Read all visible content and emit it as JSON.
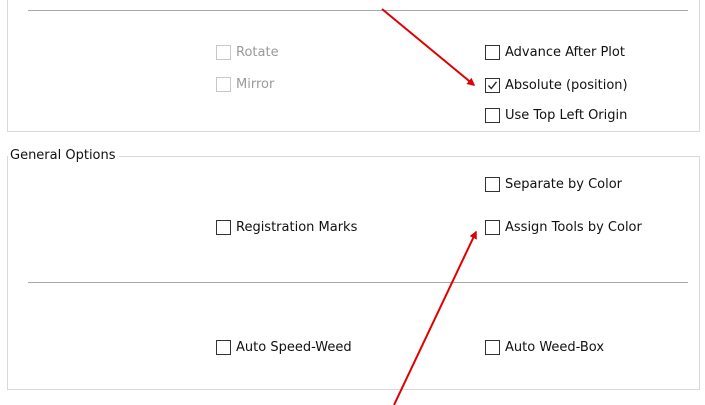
{
  "top_section": {
    "rotate_label": "Rotate",
    "mirror_label": "Mirror",
    "advance_after_plot_label": "Advance After Plot",
    "absolute_position_label": "Absolute (position)",
    "use_top_left_origin_label": "Use Top Left Origin"
  },
  "general_options": {
    "legend": "General Options",
    "separate_by_color_label": "Separate by Color",
    "registration_marks_label": "Registration Marks",
    "assign_tools_by_color_label": "Assign Tools by Color",
    "auto_speed_weed_label": "Auto Speed-Weed",
    "auto_weed_box_label": "Auto Weed-Box"
  },
  "checkbox_states": {
    "rotate": false,
    "mirror": false,
    "advance_after_plot": false,
    "absolute_position": true,
    "use_top_left_origin": false,
    "separate_by_color": false,
    "registration_marks": false,
    "assign_tools_by_color": false,
    "auto_speed_weed": false,
    "auto_weed_box": false
  },
  "colors": {
    "annotation_arrow": "#e00000",
    "panel_border": "#d9d9d9",
    "divider": "#a8a8a8",
    "disabled_text": "#9a9a9a"
  }
}
